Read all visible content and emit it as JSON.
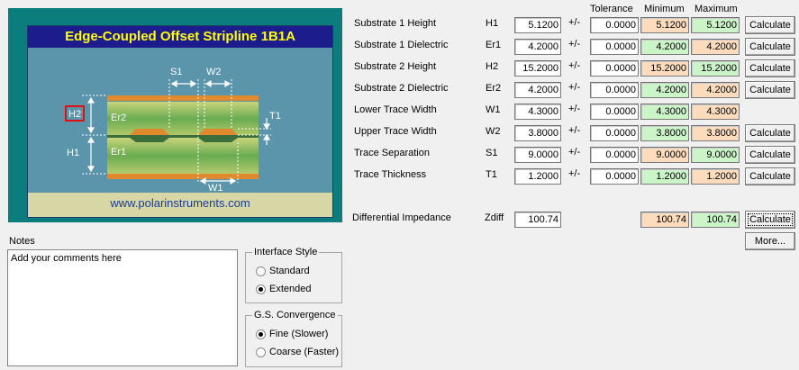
{
  "diagram": {
    "title": "Edge-Coupled Offset Stripline 1B1A",
    "footer": "www.polarinstruments.com",
    "labels": {
      "s1": "S1",
      "w2": "W2",
      "h2": "H2",
      "er2": "Er2",
      "t1": "T1",
      "h1": "H1",
      "er1": "Er1",
      "w1": "W1"
    }
  },
  "headers": {
    "tolerance": "Tolerance",
    "minimum": "Minimum",
    "maximum": "Maximum"
  },
  "params": [
    {
      "label": "Substrate 1 Height",
      "symbol": "H1",
      "value": "5.1200",
      "pm": "+/-",
      "tol": "0.0000",
      "min": "5.1200",
      "max": "5.1200",
      "min_color": "orange",
      "max_color": "green",
      "button": "Calculate"
    },
    {
      "label": "Substrate 1 Dielectric",
      "symbol": "Er1",
      "value": "4.2000",
      "pm": "+/-",
      "tol": "0.0000",
      "min": "4.2000",
      "max": "4.2000",
      "min_color": "green",
      "max_color": "orange",
      "button": "Calculate"
    },
    {
      "label": "Substrate 2 Height",
      "symbol": "H2",
      "value": "15.2000",
      "pm": "+/-",
      "tol": "0.0000",
      "min": "15.2000",
      "max": "15.2000",
      "min_color": "orange",
      "max_color": "green",
      "button": "Calculate"
    },
    {
      "label": "Substrate 2 Dielectric",
      "symbol": "Er2",
      "value": "4.2000",
      "pm": "+/-",
      "tol": "0.0000",
      "min": "4.2000",
      "max": "4.2000",
      "min_color": "green",
      "max_color": "orange",
      "button": "Calculate"
    },
    {
      "label": "Lower Trace Width",
      "symbol": "W1",
      "value": "4.3000",
      "pm": "+/-",
      "tol": "0.0000",
      "min": "4.3000",
      "max": "4.3000",
      "min_color": "green",
      "max_color": "orange",
      "button": ""
    },
    {
      "label": "Upper Trace Width",
      "symbol": "W2",
      "value": "3.8000",
      "pm": "+/-",
      "tol": "0.0000",
      "min": "3.8000",
      "max": "3.8000",
      "min_color": "green",
      "max_color": "orange",
      "button": "Calculate"
    },
    {
      "label": "Trace Separation",
      "symbol": "S1",
      "value": "9.0000",
      "pm": "+/-",
      "tol": "0.0000",
      "min": "9.0000",
      "max": "9.0000",
      "min_color": "orange",
      "max_color": "green",
      "button": "Calculate"
    },
    {
      "label": "Trace Thickness",
      "symbol": "T1",
      "value": "1.2000",
      "pm": "+/-",
      "tol": "0.0000",
      "min": "1.2000",
      "max": "1.2000",
      "min_color": "green",
      "max_color": "orange",
      "button": "Calculate"
    }
  ],
  "impedance": {
    "label": "Differential Impedance",
    "symbol": "Zdiff",
    "value": "100.74",
    "min": "100.74",
    "max": "100.74",
    "button": "Calculate",
    "more_button": "More..."
  },
  "notes": {
    "label": "Notes",
    "text": "Add your comments here"
  },
  "interface_style": {
    "title": "Interface Style",
    "options": [
      {
        "label": "Standard",
        "selected": false
      },
      {
        "label": "Extended",
        "selected": true
      }
    ]
  },
  "convergence": {
    "title": "G.S. Convergence",
    "options": [
      {
        "label": "Fine (Slower)",
        "selected": true
      },
      {
        "label": "Coarse (Faster)",
        "selected": false
      }
    ]
  },
  "colors": {
    "orange": "#fcdcbc",
    "green": "#cbf5c9",
    "diagram_bg": "#0b7d7d",
    "title_bar": "#1c1c8c",
    "title_text": "#ffff00"
  }
}
